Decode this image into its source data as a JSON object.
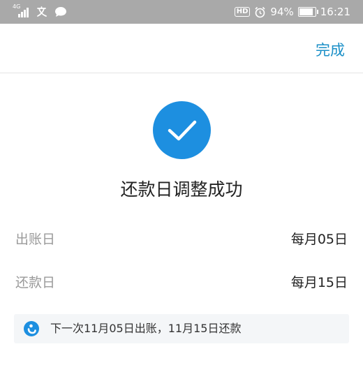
{
  "status_bar": {
    "network": "4G",
    "left_icons": [
      "signal-icon",
      "translate-icon",
      "message-bubble-icon"
    ],
    "right_badge": "HD",
    "battery_percent": "94%",
    "battery_level": 0.94,
    "time": "16:21"
  },
  "header": {
    "done_label": "完成"
  },
  "result": {
    "icon": "checkmark-circle-icon",
    "accent_color": "#1d8fe0",
    "title": "还款日调整成功"
  },
  "details": [
    {
      "label": "出账日",
      "value": "每月05日"
    },
    {
      "label": "还款日",
      "value": "每月15日"
    }
  ],
  "notice": {
    "icon": "alipay-logo-icon",
    "text": "下一次11月05日出账，11月15日还款"
  },
  "colors": {
    "link": "#1a8fc7",
    "status_bar_bg": "#a9a9a9"
  }
}
